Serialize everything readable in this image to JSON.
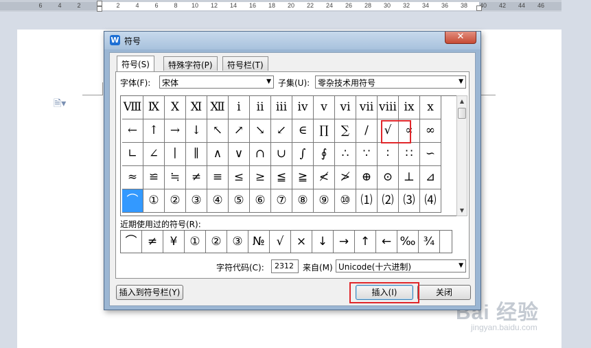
{
  "ruler": {
    "numbers": [
      "6",
      "4",
      "2",
      "2",
      "4",
      "6",
      "8",
      "10",
      "12",
      "14",
      "16",
      "18",
      "20",
      "22",
      "24",
      "26",
      "28",
      "30",
      "32",
      "34",
      "36",
      "38",
      "40",
      "42",
      "44",
      "46"
    ]
  },
  "dialog": {
    "title": "符号",
    "app_icon": "W",
    "close_label": "✕",
    "tabs": [
      {
        "label": "符号(S)",
        "active": true
      },
      {
        "label": "特殊字符(P)",
        "active": false
      },
      {
        "label": "符号栏(T)",
        "active": false
      }
    ],
    "font_label": "字体(F):",
    "font_value": "宋体",
    "subset_label": "子集(U):",
    "subset_value": "零杂技术用符号",
    "symbols": [
      [
        "Ⅷ",
        "Ⅸ",
        "Ⅹ",
        "Ⅺ",
        "Ⅻ",
        "ⅰ",
        "ⅱ",
        "ⅲ",
        "ⅳ",
        "ⅴ",
        "ⅵ",
        "ⅶ",
        "ⅷ",
        "ⅸ",
        "ⅹ"
      ],
      [
        "←",
        "↑",
        "→",
        "↓",
        "↖",
        "↗",
        "↘",
        "↙",
        "∈",
        "∏",
        "∑",
        "∕",
        "√",
        "∝",
        "∞"
      ],
      [
        "∟",
        "∠",
        "∣",
        "∥",
        "∧",
        "∨",
        "∩",
        "∪",
        "∫",
        "∮",
        "∴",
        "∵",
        "∶",
        "∷",
        "∽"
      ],
      [
        "≈",
        "≌",
        "≒",
        "≠",
        "≡",
        "≤",
        "≥",
        "≦",
        "≧",
        "≮",
        "≯",
        "⊕",
        "⊙",
        "⊥",
        "⊿"
      ],
      [
        "⌒",
        "①",
        "②",
        "③",
        "④",
        "⑤",
        "⑥",
        "⑦",
        "⑧",
        "⑨",
        "⑩",
        "⑴",
        "⑵",
        "⑶",
        "⑷"
      ]
    ],
    "recent_label": "近期使用过的符号(R):",
    "recent": [
      "⌒",
      "≠",
      "¥",
      "①",
      "②",
      "③",
      "№",
      "√",
      "×",
      "↓",
      "→",
      "↑",
      "←",
      "‰",
      "¾"
    ],
    "char_code_label": "字符代码(C):",
    "char_code_value": "2312",
    "from_label": "来自(M)",
    "from_value": "Unicode(十六进制)",
    "insert_to_bar_label": "插入到符号栏(Y)",
    "insert_label": "插入(I)",
    "close_button_label": "关闭"
  },
  "watermark": {
    "brand": "Bai 经验",
    "site": "jingyan.baidu.com"
  }
}
